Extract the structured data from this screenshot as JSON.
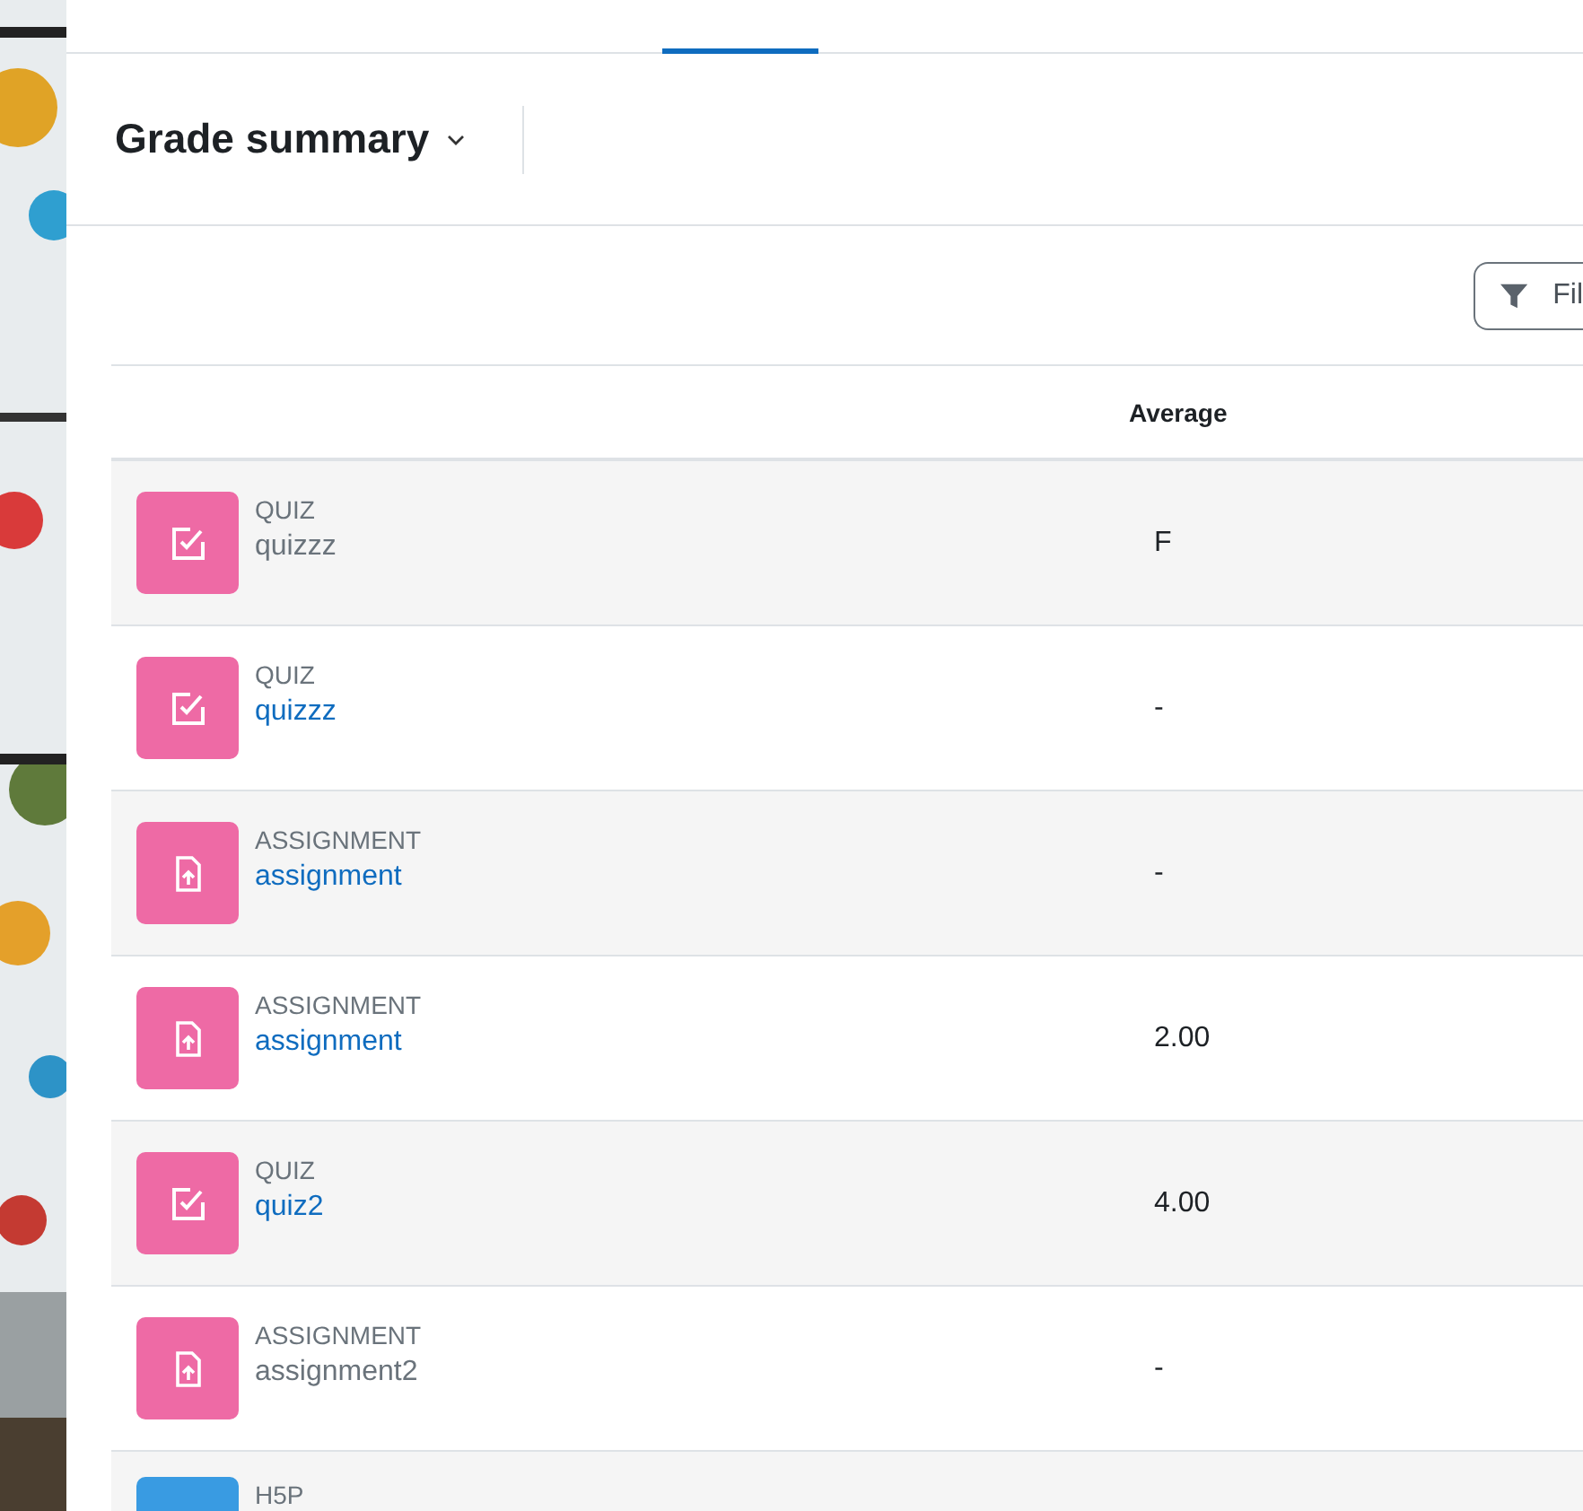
{
  "page_header": {
    "title": "Grade summary"
  },
  "filter_button": {
    "label": "Fil"
  },
  "table": {
    "columns": [
      "",
      "Average"
    ],
    "rows": [
      {
        "kind": "quiz",
        "type_label": "QUIZ",
        "name": "quizzz",
        "linked": false,
        "average": "F"
      },
      {
        "kind": "quiz",
        "type_label": "QUIZ",
        "name": "quizzz",
        "linked": true,
        "average": "-"
      },
      {
        "kind": "assignment",
        "type_label": "ASSIGNMENT",
        "name": "assignment",
        "linked": true,
        "average": "-"
      },
      {
        "kind": "assignment",
        "type_label": "ASSIGNMENT",
        "name": "assignment",
        "linked": true,
        "average": "2.00"
      },
      {
        "kind": "quiz",
        "type_label": "QUIZ",
        "name": "quiz2",
        "linked": true,
        "average": "4.00"
      },
      {
        "kind": "assignment",
        "type_label": "ASSIGNMENT",
        "name": "assignment2",
        "linked": false,
        "average": "-"
      },
      {
        "kind": "h5p",
        "type_label": "H5P"
      }
    ]
  }
}
